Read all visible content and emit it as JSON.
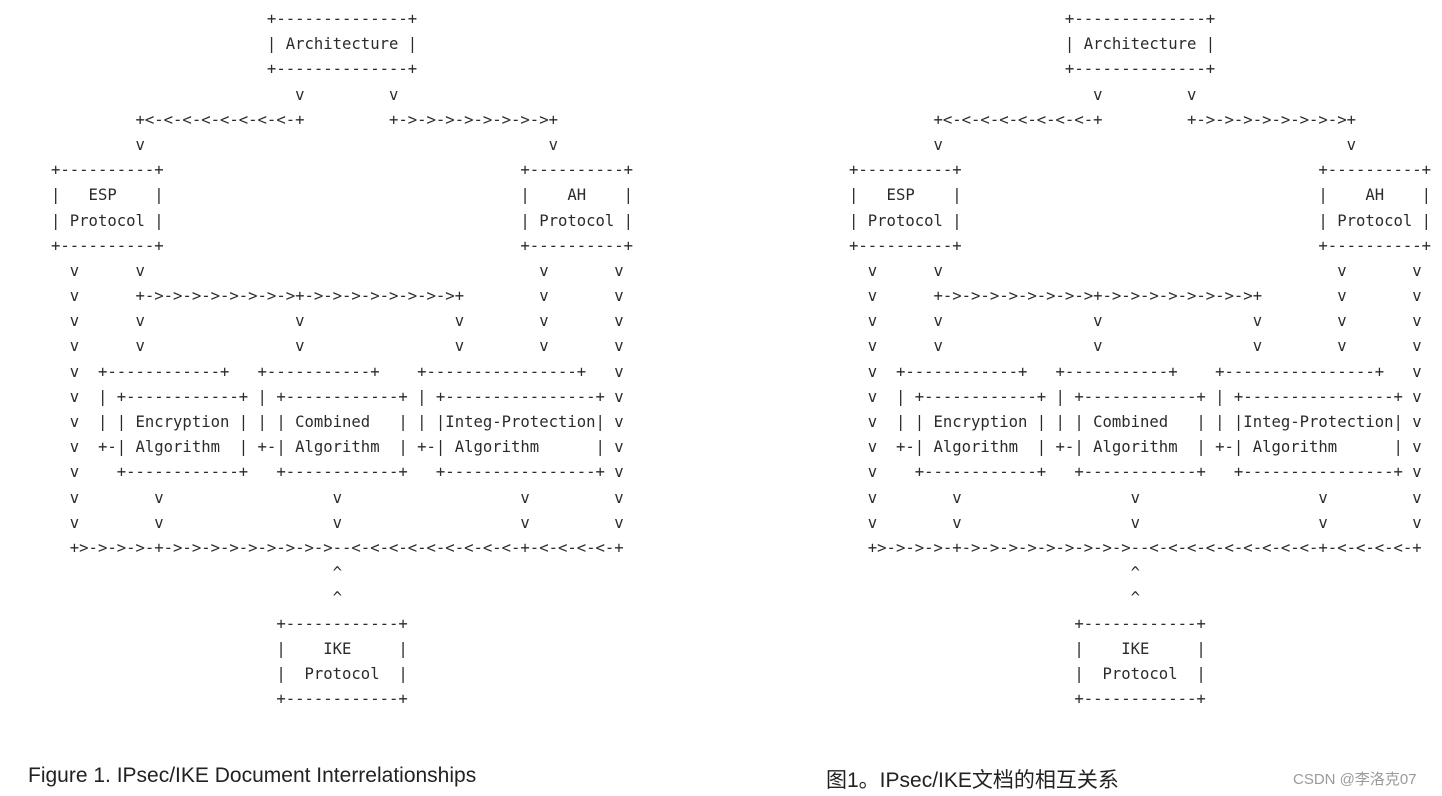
{
  "diagram": {
    "lines": [
      "                       +--------------+",
      "                       | Architecture |",
      "                       +--------------+",
      "                          v         v",
      "         +<-<-<-<-<-<-<-<-+         +->->->->->->->->+",
      "         v                                           v",
      "+----------+                                      +----------+",
      "|   ESP    |                                      |    AH    |",
      "| Protocol |                                      | Protocol |",
      "+----------+                                      +----------+",
      "  v      v                                          v       v",
      "  v      +->->->->->->->->+->->->->->->->->+        v       v",
      "  v      v                v                v        v       v",
      "  v      v                v                v        v       v",
      "  v  +------------+   +-----------+    +----------------+   v",
      "  v  | +------------+ | +------------+ | +----------------+ v",
      "  v  | | Encryption | | | Combined   | | |Integ-Protection| v",
      "  v  +-| Algorithm  | +-| Algorithm  | +-| Algorithm      | v",
      "  v    +------------+   +------------+   +----------------+ v",
      "  v        v                  v                   v         v",
      "  v        v                  v                   v         v",
      "  +>->->->-+->->->->->->->->->--<-<-<-<-<-<-<-<-<-+-<-<-<-<-+",
      "                              ^",
      "                              ^",
      "                        +------------+",
      "                        |    IKE     |",
      "                        |  Protocol  |",
      "                        +------------+"
    ],
    "pipe_colors": [
      "#2f6db5",
      "#b5651d",
      "#7a2f8f"
    ]
  },
  "captions": {
    "english": "Figure 1. IPsec/IKE Document Interrelationships",
    "chinese": "图1。IPsec/IKE文档的相互关系"
  },
  "watermark": "CSDN @李洛克07"
}
